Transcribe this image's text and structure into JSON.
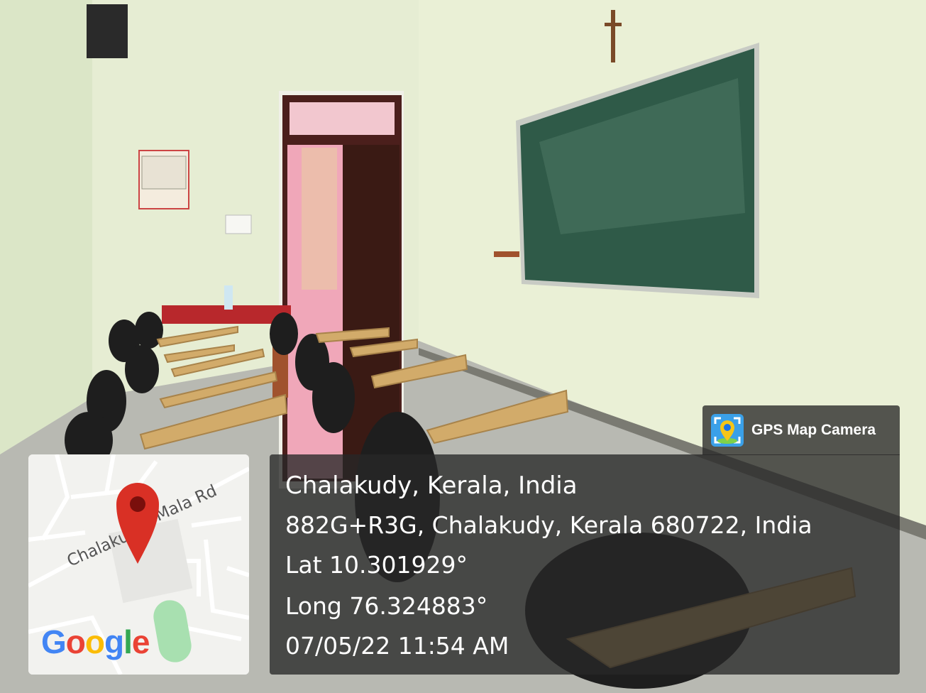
{
  "badge": {
    "label": "GPS Map Camera",
    "icon": "gps-camera-app-icon"
  },
  "location": {
    "place": "Chalakudy, Kerala, India",
    "address": "882G+R3G, Chalakudy, Kerala 680722, India",
    "lat": "Lat 10.301929°",
    "long": "Long 76.324883°",
    "datetime": "07/05/22 11:54 AM"
  },
  "map": {
    "road_label_left": "Chalaku",
    "road_label_right": "Mala Rd",
    "logo": "Google",
    "pin_color": "#d93025",
    "park_color": "#a8e0b0"
  },
  "scene": {
    "wall_color": "#e9efd6",
    "board_color": "#2f5a48",
    "floor_color": "#b9bab3",
    "desk_color": "#d2ab6a",
    "door_color": "#3a1a14"
  }
}
